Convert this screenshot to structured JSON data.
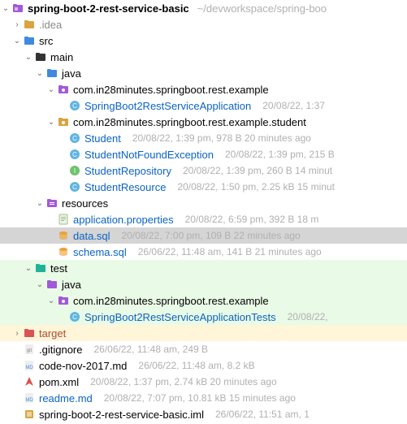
{
  "root": {
    "name": "spring-boot-2-rest-service-basic",
    "path_hint": "~/devworkspace/spring-boo"
  },
  "idea_folder": ".idea",
  "src_folder": "src",
  "main_folder": "main",
  "java_folder": "java",
  "pkg1": "com.in28minutes.springboot.rest.example",
  "app_class": "SpringBoot2RestServiceApplication",
  "app_class_meta": "20/08/22, 1:37",
  "pkg2": "com.in28minutes.springboot.rest.example.student",
  "student": {
    "name": "Student",
    "meta": "20/08/22, 1:39 pm, 978 B 20 minutes ago"
  },
  "student_nfe": {
    "name": "StudentNotFoundException",
    "meta": "20/08/22, 1:39 pm, 215 B"
  },
  "student_repo": {
    "name": "StudentRepository",
    "meta": "20/08/22, 1:39 pm, 260 B 14 minut"
  },
  "student_res": {
    "name": "StudentResource",
    "meta": "20/08/22, 1:50 pm, 2.25 kB 15 minut"
  },
  "resources_folder": "resources",
  "app_props": {
    "name": "application.properties",
    "meta": "20/08/22, 6:59 pm, 392 B 18 m"
  },
  "data_sql": {
    "name": "data.sql",
    "meta": "20/08/22, 7:00 pm, 109 B 22 minutes ago"
  },
  "schema_sql": {
    "name": "schema.sql",
    "meta": "26/06/22, 11:48 am, 141 B 21 minutes ago"
  },
  "test_folder": "test",
  "test_java_folder": "java",
  "test_pkg": "com.in28minutes.springboot.rest.example",
  "test_class": {
    "name": "SpringBoot2RestServiceApplicationTests",
    "meta": "20/08/22,"
  },
  "target_folder": "target",
  "gitignore": {
    "name": ".gitignore",
    "meta": "26/06/22, 11:48 am, 249 B"
  },
  "codenov": {
    "name": "code-nov-2017.md",
    "meta": "26/06/22, 11:48 am, 8.2 kB"
  },
  "pom": {
    "name": "pom.xml",
    "meta": "20/08/22, 1:37 pm, 2.74 kB 20 minutes ago"
  },
  "readme": {
    "name": "readme.md",
    "meta": "20/08/22, 7:07 pm, 10.81 kB 15 minutes ago"
  },
  "iml": {
    "name": "spring-boot-2-rest-service-basic.iml",
    "meta": "26/06/22, 11:51 am, 1"
  }
}
